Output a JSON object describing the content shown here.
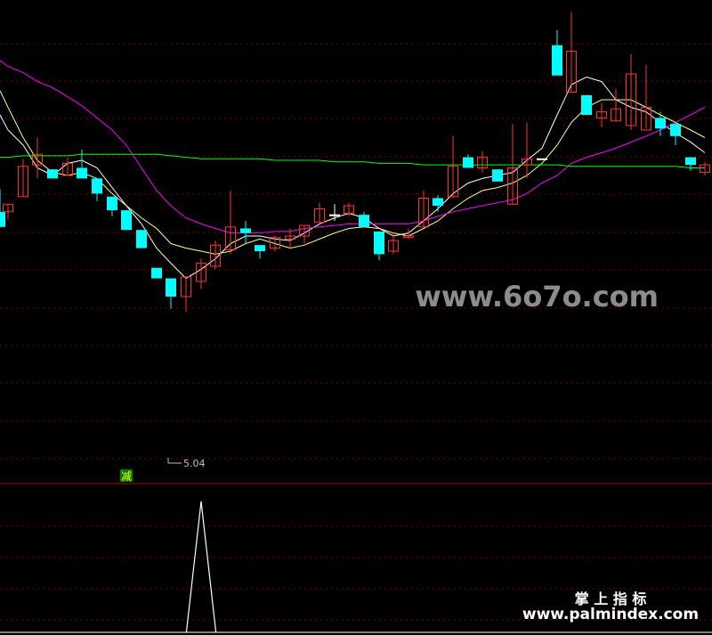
{
  "chart_data": {
    "type": "candlestick",
    "price_ylim": [
      4.6,
      7.6
    ],
    "candles": [
      {
        "o": 6.16,
        "c": 6.26,
        "h": 6.41,
        "l": 6.26,
        "dir": "down"
      },
      {
        "o": 6.26,
        "c": 6.31,
        "h": 6.31,
        "l": 6.21,
        "dir": "up"
      },
      {
        "o": 6.36,
        "c": 6.56,
        "h": 6.61,
        "l": 6.36,
        "dir": "up"
      },
      {
        "o": 6.57,
        "c": 6.64,
        "h": 6.75,
        "l": 6.48,
        "dir": "up"
      },
      {
        "o": 6.54,
        "c": 6.48,
        "h": 6.54,
        "l": 6.48,
        "dir": "down"
      },
      {
        "o": 6.5,
        "c": 6.58,
        "h": 6.62,
        "l": 6.5,
        "dir": "up"
      },
      {
        "o": 6.55,
        "c": 6.48,
        "h": 6.67,
        "l": 6.48,
        "dir": "down"
      },
      {
        "o": 6.48,
        "c": 6.38,
        "h": 6.48,
        "l": 6.33,
        "dir": "down"
      },
      {
        "o": 6.36,
        "c": 6.27,
        "h": 6.36,
        "l": 6.23,
        "dir": "down"
      },
      {
        "o": 6.27,
        "c": 6.14,
        "h": 6.27,
        "l": 6.14,
        "dir": "down"
      },
      {
        "o": 6.14,
        "c": 6.02,
        "h": 6.14,
        "l": 6.02,
        "dir": "down"
      },
      {
        "o": 5.89,
        "c": 5.82,
        "h": 5.89,
        "l": 5.82,
        "dir": "down"
      },
      {
        "o": 5.82,
        "c": 5.7,
        "h": 5.82,
        "l": 5.62,
        "dir": "down"
      },
      {
        "o": 5.7,
        "c": 5.83,
        "h": 5.83,
        "l": 5.6,
        "dir": "up"
      },
      {
        "o": 5.8,
        "c": 5.92,
        "h": 5.95,
        "l": 5.75,
        "dir": "up"
      },
      {
        "o": 5.9,
        "c": 6.04,
        "h": 6.07,
        "l": 5.88,
        "dir": "up"
      },
      {
        "o": 6.01,
        "c": 6.16,
        "h": 6.4,
        "l": 5.98,
        "dir": "up"
      },
      {
        "o": 6.15,
        "c": 6.12,
        "h": 6.2,
        "l": 6.05,
        "dir": "down"
      },
      {
        "o": 6.04,
        "c": 6.0,
        "h": 6.04,
        "l": 5.95,
        "dir": "down"
      },
      {
        "o": 6.02,
        "c": 6.09,
        "h": 6.1,
        "l": 6.0,
        "dir": "up"
      },
      {
        "o": 6.08,
        "c": 6.1,
        "h": 6.15,
        "l": 6.02,
        "dir": "up"
      },
      {
        "o": 6.1,
        "c": 6.17,
        "h": 6.17,
        "l": 6.05,
        "dir": "up"
      },
      {
        "o": 6.19,
        "c": 6.28,
        "h": 6.32,
        "l": 6.19,
        "dir": "up"
      },
      {
        "o": 6.24,
        "c": 6.24,
        "h": 6.31,
        "l": 6.2,
        "dir": "flat"
      },
      {
        "o": 6.25,
        "c": 6.3,
        "h": 6.32,
        "l": 6.23,
        "dir": "up"
      },
      {
        "o": 6.24,
        "c": 6.16,
        "h": 6.26,
        "l": 6.16,
        "dir": "down"
      },
      {
        "o": 6.13,
        "c": 5.98,
        "h": 6.13,
        "l": 5.94,
        "dir": "down"
      },
      {
        "o": 6.0,
        "c": 6.07,
        "h": 6.12,
        "l": 5.98,
        "dir": "up"
      },
      {
        "o": 6.1,
        "c": 6.09,
        "h": 6.15,
        "l": 6.08,
        "dir": "up"
      },
      {
        "o": 6.16,
        "c": 6.35,
        "h": 6.4,
        "l": 6.16,
        "dir": "up"
      },
      {
        "o": 6.35,
        "c": 6.3,
        "h": 6.37,
        "l": 6.26,
        "dir": "down"
      },
      {
        "o": 6.36,
        "c": 6.56,
        "h": 6.76,
        "l": 6.35,
        "dir": "up"
      },
      {
        "o": 6.62,
        "c": 6.55,
        "h": 6.64,
        "l": 6.55,
        "dir": "down"
      },
      {
        "o": 6.55,
        "c": 6.62,
        "h": 6.66,
        "l": 6.52,
        "dir": "up"
      },
      {
        "o": 6.54,
        "c": 6.46,
        "h": 6.54,
        "l": 6.46,
        "dir": "down"
      },
      {
        "o": 6.31,
        "c": 6.55,
        "h": 6.84,
        "l": 6.31,
        "dir": "up"
      },
      {
        "o": 6.57,
        "c": 6.61,
        "h": 6.85,
        "l": 6.48,
        "dir": "up"
      },
      {
        "o": 6.61,
        "c": 6.61,
        "h": 6.61,
        "l": 6.61,
        "dir": "flat"
      },
      {
        "o": 7.36,
        "c": 7.16,
        "h": 7.46,
        "l": 7.16,
        "dir": "down"
      },
      {
        "o": 7.05,
        "c": 7.32,
        "h": 7.58,
        "l": 7.05,
        "dir": "up"
      },
      {
        "o": 7.03,
        "c": 6.9,
        "h": 7.03,
        "l": 6.9,
        "dir": "down"
      },
      {
        "o": 6.88,
        "c": 6.92,
        "h": 6.98,
        "l": 6.82,
        "dir": "up"
      },
      {
        "o": 6.86,
        "c": 6.94,
        "h": 7.07,
        "l": 6.86,
        "dir": "up"
      },
      {
        "o": 6.83,
        "c": 7.17,
        "h": 7.3,
        "l": 6.8,
        "dir": "up"
      },
      {
        "o": 6.8,
        "c": 6.95,
        "h": 7.23,
        "l": 6.81,
        "dir": "up"
      },
      {
        "o": 6.88,
        "c": 6.81,
        "h": 6.92,
        "l": 6.76,
        "dir": "down"
      },
      {
        "o": 6.84,
        "c": 6.76,
        "h": 6.85,
        "l": 6.7,
        "dir": "down"
      },
      {
        "o": 6.62,
        "c": 6.57,
        "h": 6.62,
        "l": 6.53,
        "dir": "down"
      },
      {
        "o": 6.52,
        "c": 6.57,
        "h": 6.59,
        "l": 6.5,
        "dir": "up"
      }
    ],
    "x_slots": [
      9,
      26,
      42,
      59,
      76,
      92,
      109,
      126,
      142,
      159,
      176,
      192,
      209,
      226,
      242,
      259,
      276,
      292,
      309,
      326,
      342,
      359,
      376,
      392,
      409,
      426,
      442,
      459,
      476,
      492,
      509,
      526,
      542,
      559,
      576,
      592,
      609,
      626,
      642,
      659,
      676,
      692,
      709,
      726,
      742,
      759,
      776,
      792
    ],
    "ma_lines": [
      {
        "color": "#ffffff",
        "values": [
          6.9,
          6.8,
          6.7,
          6.55,
          6.5,
          6.58,
          6.6,
          6.55,
          6.42,
          6.3,
          6.18,
          6.02,
          5.92,
          5.82,
          5.88,
          5.95,
          6.05,
          6.1,
          6.1,
          6.08,
          6.07,
          6.12,
          6.18,
          6.22,
          6.25,
          6.22,
          6.15,
          6.1,
          6.12,
          6.2,
          6.28,
          6.38,
          6.45,
          6.48,
          6.5,
          6.52,
          6.6,
          6.68,
          6.9,
          7.1,
          7.15,
          7.12,
          7.0,
          6.95,
          6.92,
          6.85,
          6.78,
          6.72,
          6.65
        ]
      },
      {
        "color": "#ffff80",
        "values": [
          7.06,
          6.95,
          6.75,
          6.6,
          6.52,
          6.5,
          6.52,
          6.48,
          6.38,
          6.3,
          6.22,
          6.15,
          6.05,
          6.02,
          6.0,
          5.98,
          6.0,
          6.05,
          6.08,
          6.05,
          6.02,
          6.04,
          6.08,
          6.12,
          6.15,
          6.16,
          6.15,
          6.12,
          6.1,
          6.15,
          6.2,
          6.28,
          6.35,
          6.4,
          6.42,
          6.45,
          6.5,
          6.58,
          6.7,
          6.85,
          6.95,
          7.0,
          7.0,
          7.0,
          6.95,
          6.9,
          6.85,
          6.8,
          6.75
        ]
      },
      {
        "color": "#ff00ff",
        "values": [
          7.26,
          7.22,
          7.18,
          7.12,
          7.08,
          7.02,
          6.96,
          6.88,
          6.8,
          6.7,
          6.55,
          6.4,
          6.3,
          6.22,
          6.18,
          6.15,
          6.12,
          6.12,
          6.12,
          6.13,
          6.13,
          6.15,
          6.16,
          6.17,
          6.18,
          6.18,
          6.18,
          6.18,
          6.18,
          6.2,
          6.23,
          6.26,
          6.28,
          6.3,
          6.32,
          6.34,
          6.38,
          6.45,
          6.5,
          6.58,
          6.62,
          6.65,
          6.68,
          6.72,
          6.76,
          6.8,
          6.85,
          6.9,
          6.95
        ]
      },
      {
        "color": "#00ff00",
        "values": [
          6.62,
          6.62,
          6.63,
          6.63,
          6.63,
          6.63,
          6.64,
          6.64,
          6.64,
          6.64,
          6.64,
          6.64,
          6.63,
          6.62,
          6.61,
          6.61,
          6.61,
          6.61,
          6.61,
          6.6,
          6.6,
          6.6,
          6.6,
          6.59,
          6.59,
          6.59,
          6.58,
          6.58,
          6.58,
          6.57,
          6.57,
          6.57,
          6.57,
          6.57,
          6.57,
          6.57,
          6.57,
          6.57,
          6.57,
          6.56,
          6.56,
          6.56,
          6.56,
          6.56,
          6.56,
          6.56,
          6.56,
          6.55,
          6.55
        ]
      }
    ],
    "min_marker_label": "5.04",
    "min_marker_index": 12,
    "signal_label": "减",
    "signal_index": 8,
    "indicator": {
      "values": [
        0,
        0,
        0,
        0,
        0,
        0,
        0,
        0,
        0,
        0,
        0,
        0,
        0,
        0,
        1,
        0,
        0,
        0,
        0,
        0,
        0,
        0,
        0,
        0,
        0,
        0,
        0,
        0,
        0,
        0,
        0,
        0,
        0,
        0,
        0,
        0,
        0,
        0,
        0,
        0,
        0,
        0,
        0,
        0,
        0,
        0,
        0,
        0,
        0
      ],
      "peak_index": 14
    }
  },
  "watermark_mid": "www.6o7o.com",
  "watermark_brand": "掌 上 指 标",
  "watermark_url": "www.palmindex.com",
  "colors": {
    "up": "#ff3333",
    "down": "#00ffff",
    "grid": "#800000",
    "divider": "#c00000",
    "indicator": "#ffffff",
    "label": "#c0c0c0",
    "signal_bg": "#008000",
    "signal_fg": "#ffff00"
  }
}
